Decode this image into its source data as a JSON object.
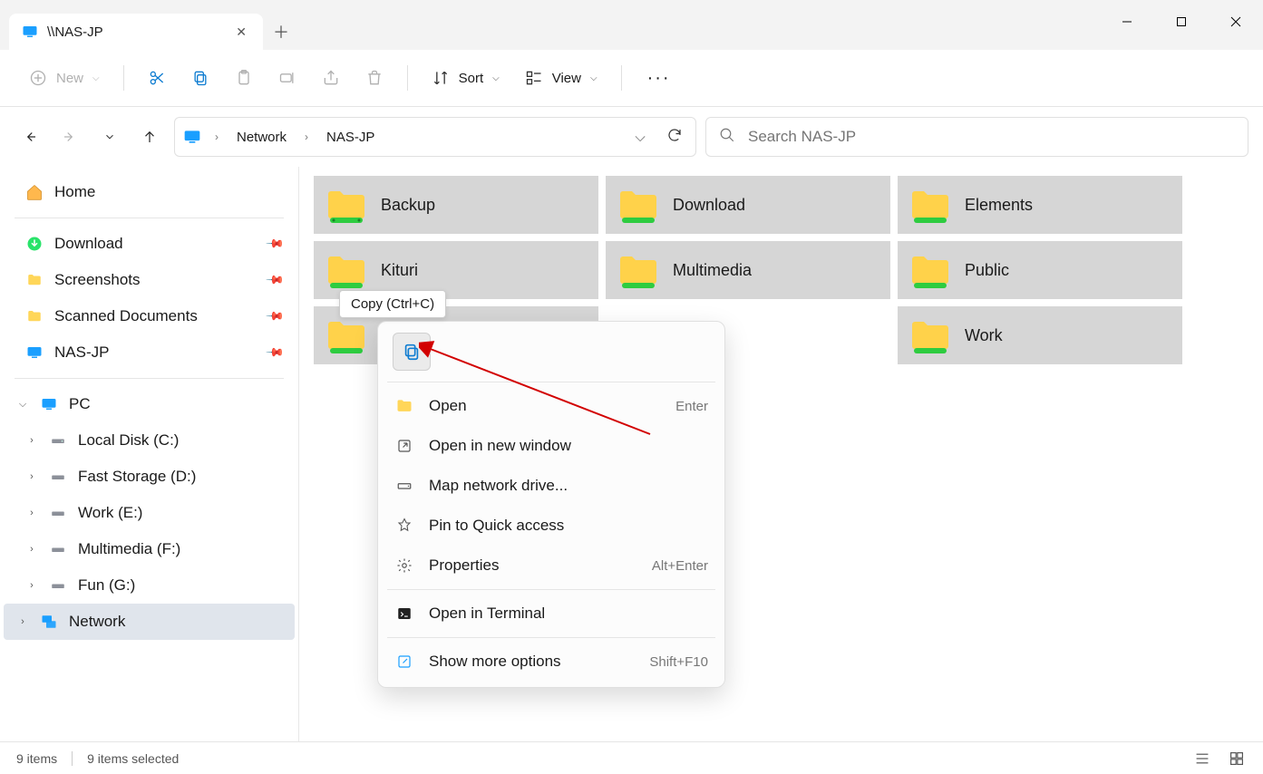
{
  "tab": {
    "title": "\\\\NAS-JP"
  },
  "toolbar": {
    "new": "New",
    "sort": "Sort",
    "view": "View"
  },
  "breadcrumb": {
    "seg1": "Network",
    "seg2": "NAS-JP"
  },
  "search": {
    "placeholder": "Search NAS-JP"
  },
  "sidebar": {
    "home": "Home",
    "download": "Download",
    "screenshots": "Screenshots",
    "scanned": "Scanned Documents",
    "nasjp": "NAS-JP",
    "pc": "PC",
    "localc": "Local Disk (C:)",
    "faststorage": "Fast Storage (D:)",
    "worke": "Work (E:)",
    "multimediaf": "Multimedia (F:)",
    "fung": "Fun (G:)",
    "network": "Network"
  },
  "folders": {
    "f0": "Backup",
    "f1": "Download",
    "f2": "Elements",
    "f3": "Kituri",
    "f4": "Multimedia",
    "f5": "Public",
    "f6": "",
    "f7": "",
    "f8": "Work"
  },
  "tooltip": "Copy (Ctrl+C)",
  "context": {
    "open": "Open",
    "open_accel": "Enter",
    "open_new": "Open in new window",
    "map_drive": "Map network drive...",
    "pin_quick": "Pin to Quick access",
    "properties": "Properties",
    "properties_accel": "Alt+Enter",
    "open_terminal": "Open in Terminal",
    "more": "Show more options",
    "more_accel": "Shift+F10"
  },
  "status": {
    "count": "9 items",
    "selected": "9 items selected"
  }
}
